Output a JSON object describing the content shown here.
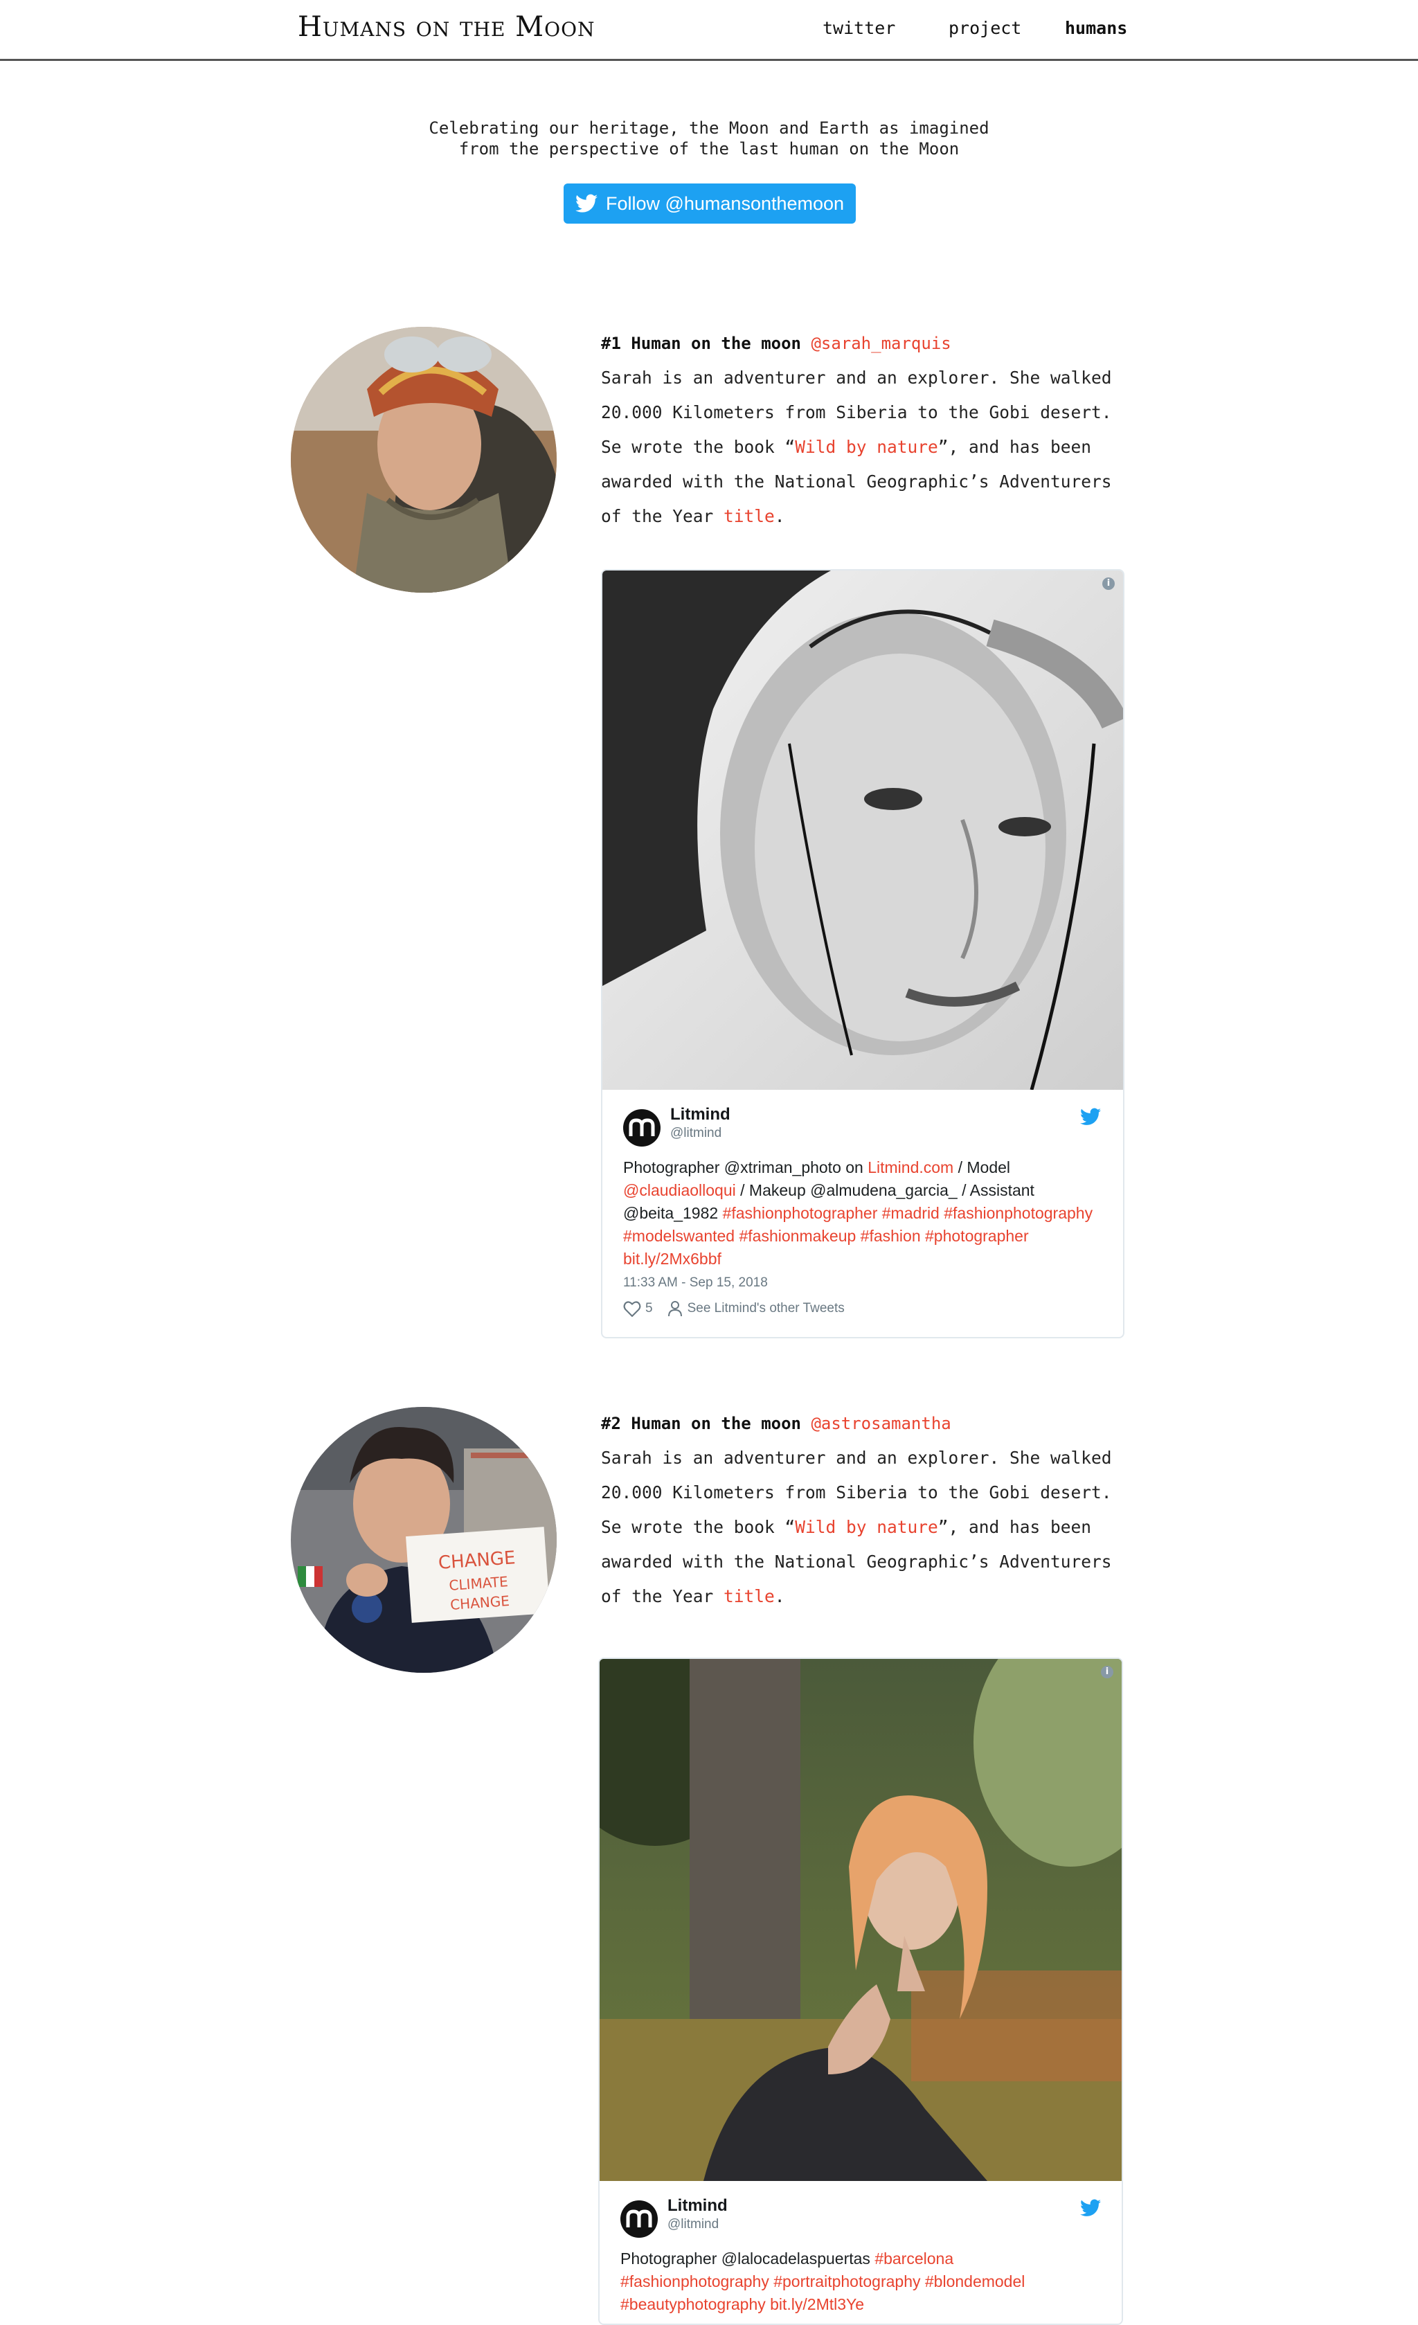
{
  "header": {
    "title": "Humans on the Moon",
    "nav": [
      {
        "label": "twitter",
        "active": false
      },
      {
        "label": "project",
        "active": false
      },
      {
        "label": "humans",
        "active": true
      }
    ]
  },
  "intro": {
    "line1": "Celebrating our heritage, the Moon and Earth as imagined",
    "line2": "from the perspective of the last human on the Moon",
    "follow_label": "Follow @humansonthemoon"
  },
  "humans": [
    {
      "number": "#1 Human on the moon",
      "handle": "@sarah_marquis",
      "bio_part1": "Sarah is an adventurer and an explorer. She walked 20.000 Kilometers from Siberia to the Gobi desert. Se wrote the book “",
      "bio_link": "Wild by nature",
      "bio_part2": "”, and has been awarded with the National Geographic’s Adventurers of the Year ",
      "bio_link2": "title",
      "bio_end": ".",
      "tweet": {
        "name": "Litmind",
        "handle": "@litmind",
        "text_segments": [
          {
            "t": "Photographer @xtriman_photo on ",
            "link": false
          },
          {
            "t": "Litmind.com",
            "link": true
          },
          {
            "t": " / Model ",
            "link": false
          },
          {
            "t": "@claudiaolloqui",
            "link": true
          },
          {
            "t": " / Makeup @almudena_garcia_ / Assistant @beita_1982 ",
            "link": false
          },
          {
            "t": "#fashionphotographer #madrid #fashionphotography #modelswanted #fashionmakeup #fashion #photographer bit.ly/2Mx6bbf",
            "link": true
          }
        ],
        "time": "11:33 AM - Sep 15, 2018",
        "likes": "5",
        "other_tweets": "See Litmind's other Tweets"
      }
    },
    {
      "number": "#2 Human on the moon",
      "handle": "@astrosamantha",
      "bio_part1": "Sarah is an adventurer and an explorer. She walked 20.000 Kilometers from Siberia to the Gobi desert. Se wrote the book “",
      "bio_link": "Wild by nature",
      "bio_part2": "”, and has been awarded with the National Geographic’s Adventurers of the Year ",
      "bio_link2": "title",
      "bio_end": ".",
      "sign": {
        "l1": "CHANGE",
        "l2": "CLIMATE",
        "l3": "CHANGE"
      },
      "tweet": {
        "name": "Litmind",
        "handle": "@litmind",
        "text_segments": [
          {
            "t": "Photographer @lalocadelaspuertas ",
            "link": false
          },
          {
            "t": "#barcelona #fashionphotography #portraitphotography #blondemodel #beautyphotography bit.ly/2Mtl3Ye",
            "link": true
          }
        ]
      }
    }
  ],
  "colors": {
    "accent": "#e8432f",
    "twitter_blue": "#1da1f2"
  }
}
